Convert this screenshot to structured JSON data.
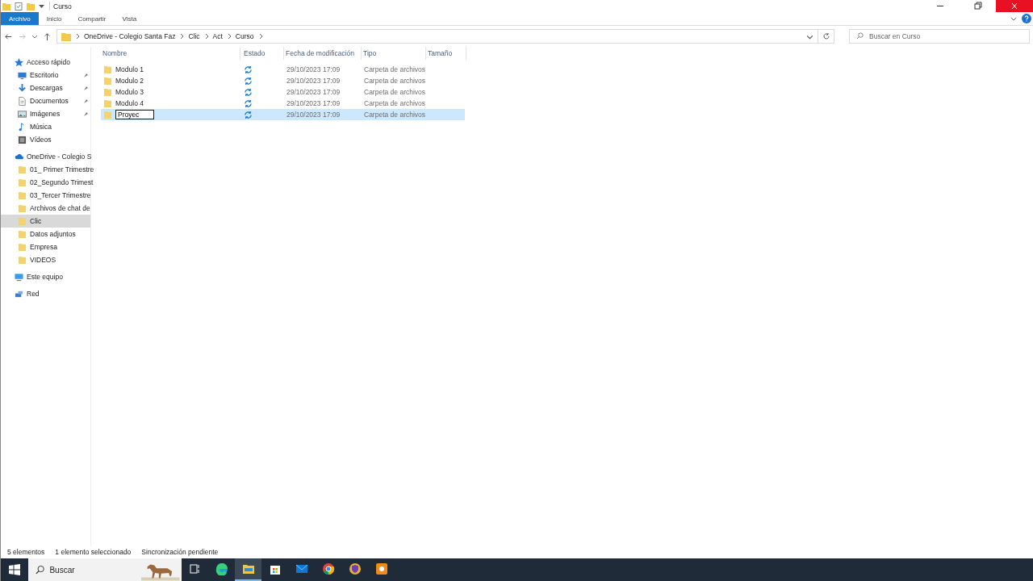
{
  "window": {
    "title": "Curso"
  },
  "ribbon_tabs": [
    {
      "label": "Archivo",
      "selected": true
    },
    {
      "label": "Inicio",
      "selected": false
    },
    {
      "label": "Compartir",
      "selected": false
    },
    {
      "label": "Vista",
      "selected": false
    }
  ],
  "address": {
    "path": [
      "OneDrive - Colegio Santa Faz",
      "Clic",
      "Act",
      "Curso"
    ]
  },
  "search": {
    "placeholder": "Buscar en Curso"
  },
  "sidebar": {
    "items": [
      {
        "label": "Acceso rápido",
        "kind": "star",
        "selected": false,
        "children": [
          {
            "label": "Escritorio",
            "kind": "desktop",
            "pinned": true,
            "selected": false
          },
          {
            "label": "Descargas",
            "kind": "download",
            "pinned": true,
            "selected": false
          },
          {
            "label": "Documentos",
            "kind": "document",
            "pinned": true,
            "selected": false
          },
          {
            "label": "Imágenes",
            "kind": "image",
            "pinned": true,
            "selected": false
          },
          {
            "label": "Música",
            "kind": "music",
            "pinned": false,
            "selected": false
          },
          {
            "label": "Vídeos",
            "kind": "video",
            "pinned": false,
            "selected": false
          }
        ]
      },
      {
        "label": "OneDrive - Colegio S",
        "kind": "cloud",
        "selected": false,
        "children": [
          {
            "label": "01_ Primer Trimestre",
            "kind": "folder",
            "pinned": false,
            "selected": false
          },
          {
            "label": "02_Segundo Trimest",
            "kind": "folder",
            "pinned": false,
            "selected": false
          },
          {
            "label": "03_Tercer Trimestre",
            "kind": "folder",
            "pinned": false,
            "selected": false
          },
          {
            "label": "Archivos de chat de",
            "kind": "folder",
            "pinned": false,
            "selected": false
          },
          {
            "label": "Clic",
            "kind": "folder",
            "pinned": false,
            "selected": true
          },
          {
            "label": "Datos adjuntos",
            "kind": "folder",
            "pinned": false,
            "selected": false
          },
          {
            "label": "Empresa",
            "kind": "folder",
            "pinned": false,
            "selected": false
          },
          {
            "label": "VIDEOS",
            "kind": "folder",
            "pinned": false,
            "selected": false
          }
        ]
      },
      {
        "label": "Este equipo",
        "kind": "pc",
        "selected": false
      },
      {
        "label": "Red",
        "kind": "network",
        "selected": false
      }
    ]
  },
  "table": {
    "columns": [
      "Nombre",
      "Estado",
      "Fecha de modificación",
      "Tipo",
      "Tamaño"
    ],
    "rows": [
      {
        "name": "Modulo 1",
        "date": "29/10/2023 17:09",
        "type": "Carpeta de archivos",
        "selected": false,
        "renaming": false
      },
      {
        "name": "Modulo 2",
        "date": "29/10/2023 17:09",
        "type": "Carpeta de archivos",
        "selected": false,
        "renaming": false
      },
      {
        "name": "Modulo 3",
        "date": "29/10/2023 17:09",
        "type": "Carpeta de archivos",
        "selected": false,
        "renaming": false
      },
      {
        "name": "Modulo 4",
        "date": "29/10/2023 17:09",
        "type": "Carpeta de archivos",
        "selected": false,
        "renaming": false
      },
      {
        "name": "Proyec",
        "date": "29/10/2023 17:09",
        "type": "Carpeta de archivos",
        "selected": true,
        "renaming": true
      }
    ]
  },
  "status_bar": [
    "5 elementos",
    "1 elemento seleccionado",
    "Sincronización pendiente"
  ],
  "taskbar": {
    "search_placeholder": "Buscar",
    "apps": [
      {
        "kind": "taskview",
        "active": false
      },
      {
        "kind": "edge",
        "active": false
      },
      {
        "kind": "explorer",
        "active": true
      },
      {
        "kind": "store",
        "active": false
      },
      {
        "kind": "mail",
        "active": false
      },
      {
        "kind": "chrome",
        "active": false
      },
      {
        "kind": "vpn",
        "active": false
      },
      {
        "kind": "recorder",
        "active": false
      }
    ]
  }
}
